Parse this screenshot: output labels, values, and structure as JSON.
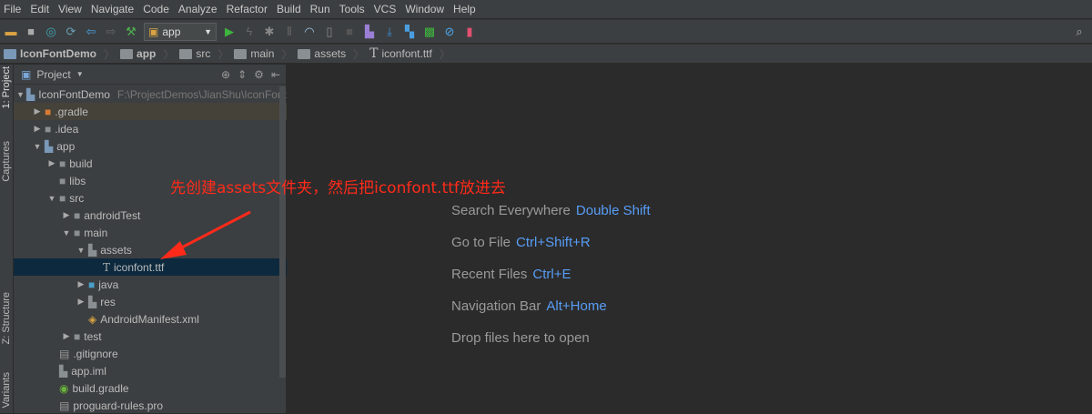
{
  "menu": [
    "File",
    "Edit",
    "View",
    "Navigate",
    "Code",
    "Analyze",
    "Refactor",
    "Build",
    "Run",
    "Tools",
    "VCS",
    "Window",
    "Help"
  ],
  "toolbar": {
    "run_config": "app"
  },
  "breadcrumbs": [
    "IconFontDemo",
    "app",
    "src",
    "main",
    "assets",
    "iconfont.ttf"
  ],
  "tool_strip": {
    "project": "1: Project",
    "captures": "Captures",
    "structure": "Z: Structure",
    "variants": "Variants"
  },
  "panel": {
    "title": "Project",
    "root_path": "F:\\ProjectDemos\\JianShu\\IconFont"
  },
  "tree": [
    {
      "label": "IconFontDemo",
      "level": 0,
      "arrow": "down",
      "icon": "module"
    },
    {
      "label": ".gradle",
      "level": 1,
      "arrow": "right",
      "icon": "folder-orange"
    },
    {
      "label": ".idea",
      "level": 1,
      "arrow": "right",
      "icon": "folder"
    },
    {
      "label": "app",
      "level": 1,
      "arrow": "down",
      "icon": "module"
    },
    {
      "label": "build",
      "level": 2,
      "arrow": "right",
      "icon": "folder"
    },
    {
      "label": "libs",
      "level": 2,
      "arrow": "",
      "icon": "folder"
    },
    {
      "label": "src",
      "level": 2,
      "arrow": "down",
      "icon": "folder"
    },
    {
      "label": "androidTest",
      "level": 3,
      "arrow": "right",
      "icon": "folder"
    },
    {
      "label": "main",
      "level": 3,
      "arrow": "down",
      "icon": "folder"
    },
    {
      "label": "assets",
      "level": 4,
      "arrow": "down",
      "icon": "resource-folder"
    },
    {
      "label": "iconfont.ttf",
      "level": 5,
      "arrow": "",
      "icon": "font-file",
      "selected": true
    },
    {
      "label": "java",
      "level": 4,
      "arrow": "right",
      "icon": "source-folder"
    },
    {
      "label": "res",
      "level": 4,
      "arrow": "right",
      "icon": "resource-folder"
    },
    {
      "label": "AndroidManifest.xml",
      "level": 4,
      "arrow": "",
      "icon": "manifest-file"
    },
    {
      "label": "test",
      "level": 3,
      "arrow": "right",
      "icon": "folder"
    },
    {
      "label": ".gitignore",
      "level": 2,
      "arrow": "",
      "icon": "text-file"
    },
    {
      "label": "app.iml",
      "level": 2,
      "arrow": "",
      "icon": "module-file"
    },
    {
      "label": "build.gradle",
      "level": 2,
      "arrow": "",
      "icon": "gradle-file"
    },
    {
      "label": "proguard-rules.pro",
      "level": 2,
      "arrow": "",
      "icon": "text-file"
    }
  ],
  "annotation": "先创建assets文件夹，然后把iconfont.ttf放进去",
  "editor_hints": [
    {
      "text": "Search Everywhere",
      "key": "Double Shift"
    },
    {
      "text": "Go to File",
      "key": "Ctrl+Shift+R"
    },
    {
      "text": "Recent Files",
      "key": "Ctrl+E"
    },
    {
      "text": "Navigation Bar",
      "key": "Alt+Home"
    },
    {
      "text": "Drop files here to open",
      "key": ""
    }
  ]
}
